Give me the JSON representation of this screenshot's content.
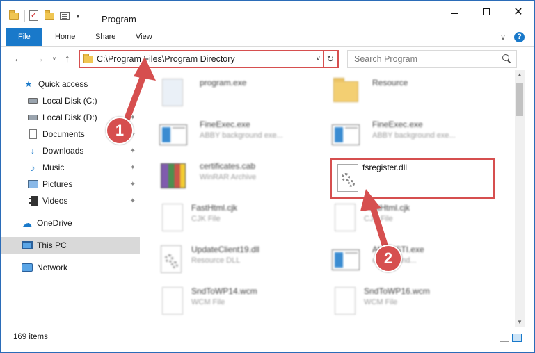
{
  "window": {
    "title": "Program"
  },
  "ribbon": {
    "tabs": [
      "File",
      "Home",
      "Share",
      "View"
    ]
  },
  "address": {
    "path": "C:\\Program Files\\Program Directory"
  },
  "search": {
    "placeholder": "Search Program"
  },
  "sidebar": {
    "items": [
      {
        "label": "Quick access",
        "icon": "star-icon"
      },
      {
        "label": "Local Disk (C:)",
        "icon": "drive-icon",
        "pinned": true
      },
      {
        "label": "Local Disk (D:)",
        "icon": "drive-icon",
        "pinned": true
      },
      {
        "label": "Documents",
        "icon": "documents-icon",
        "pinned": true
      },
      {
        "label": "Downloads",
        "icon": "download-icon",
        "pinned": true
      },
      {
        "label": "Music",
        "icon": "music-icon",
        "pinned": true
      },
      {
        "label": "Pictures",
        "icon": "pictures-icon",
        "pinned": true
      },
      {
        "label": "Videos",
        "icon": "videos-icon",
        "pinned": true
      },
      {
        "label": "OneDrive",
        "icon": "cloud-icon"
      },
      {
        "label": "This PC",
        "icon": "computer-icon",
        "selected": true
      },
      {
        "label": "Network",
        "icon": "network-icon"
      }
    ]
  },
  "files": [
    {
      "name": "program.exe",
      "type": "",
      "icon": "installer-icon"
    },
    {
      "name": "Resource",
      "type": "",
      "icon": "folder-icon"
    },
    {
      "name": "FineExec.exe",
      "type": "ABBY background exe...",
      "icon": "exe-icon"
    },
    {
      "name": "FineExec.exe",
      "type": "ABBY background exe...",
      "icon": "exe-icon"
    },
    {
      "name": "certificates.cab",
      "type": "WinRAR Archive",
      "icon": "archive-icon"
    },
    {
      "name": "fsregister.dll",
      "type": "",
      "icon": "dll-gear-icon",
      "highlighted": true
    },
    {
      "name": "FastHtml.cjk",
      "type": "CJK File",
      "icon": "file-icon"
    },
    {
      "name": "FastHtml.cjk",
      "type": "CJK File",
      "icon": "file-icon"
    },
    {
      "name": "UpdateClient19.dll",
      "type": "Resource DLL",
      "icon": "dll-gear-icon"
    },
    {
      "name": "AbbyySTI.exe",
      "type": "event hand...",
      "icon": "exe-icon"
    },
    {
      "name": "SndToWP14.wcm",
      "type": "WCM File",
      "icon": "file-icon"
    },
    {
      "name": "SndToWP16.wcm",
      "type": "WCM File",
      "icon": "file-icon"
    }
  ],
  "status": {
    "item_count": "169 items"
  },
  "annotations": {
    "step1": "1",
    "step2": "2",
    "color": "#d64f4f"
  },
  "colors": {
    "accent": "#1979ca",
    "highlight": "#d64f4f"
  }
}
